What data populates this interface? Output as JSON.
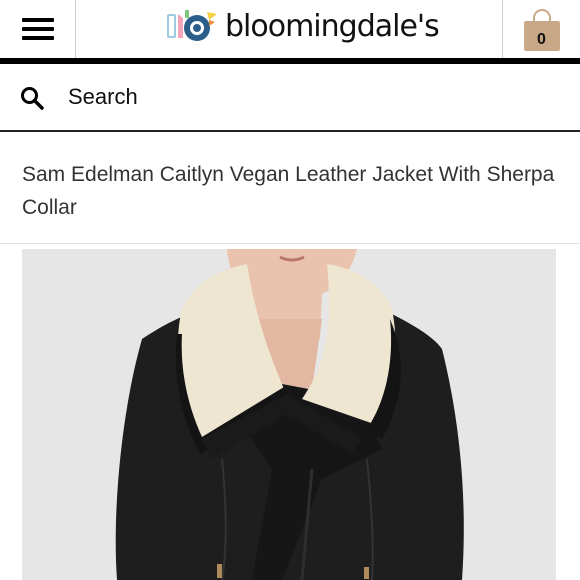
{
  "header": {
    "logo_text": "bloomingdale's",
    "menu_icon": "hamburger-menu-icon",
    "bag_icon": "shopping-bag-icon",
    "bag_count": "0"
  },
  "search": {
    "label": "Search",
    "icon": "search-icon"
  },
  "product": {
    "title": "Sam Edelman Caitlyn Vegan Leather Jacket With Sherpa Collar"
  },
  "colors": {
    "header_border": "#000000",
    "bag_color": "#c8a887",
    "jacket": "#1c1c1c",
    "sherpa": "#efe6d2",
    "background": "#e4e4e4"
  }
}
